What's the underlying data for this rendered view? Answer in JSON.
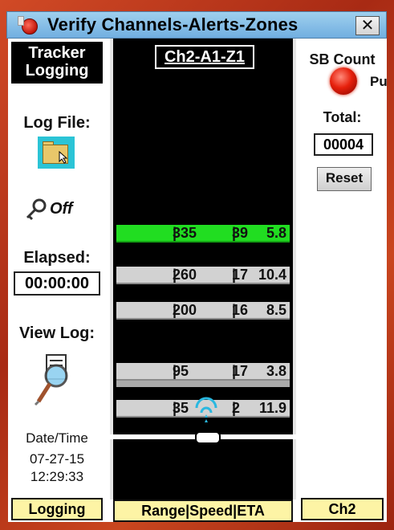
{
  "window": {
    "title": "Verify Channels-Alerts-Zones",
    "close_glyph": "✕"
  },
  "left_panel": {
    "tracker_label_line1": "Tracker",
    "tracker_label_line2": "Logging",
    "log_file_label": "Log File:",
    "logging_state": "Off",
    "elapsed_label": "Elapsed:",
    "elapsed_value": "00:00:00",
    "view_log_label": "View Log:",
    "datetime_label": "Date/Time",
    "date_value": "07-27-15",
    "time_value": "12:29:33",
    "status_button": "Logging"
  },
  "track": {
    "title": "Ch2-A1-Z1",
    "footer_label": "Range|Speed|ETA",
    "targets": [
      {
        "range": "335",
        "speed": "39",
        "eta": "5.8",
        "highlight": "green"
      },
      {
        "range": "260",
        "speed": "17",
        "eta": "10.4",
        "highlight": "gray"
      },
      {
        "range": "200",
        "speed": "16",
        "eta": "8.5",
        "highlight": "gray"
      },
      {
        "range": "95",
        "speed": "17",
        "eta": "3.8",
        "highlight": "gray"
      },
      {
        "range": "35",
        "speed": "2",
        "eta": "11.9",
        "highlight": "gray"
      }
    ],
    "separator": "|"
  },
  "right_panel": {
    "sb_count_label": "SB Count",
    "led_label": "Pu",
    "total_label": "Total:",
    "total_value": "00004",
    "reset_button": "Reset",
    "channel_button": "Ch2"
  },
  "colors": {
    "frame": "#c23a1e",
    "title_bar": "#80b9e6",
    "track_bg": "#000000",
    "target_gray": "#d2d2d2",
    "target_green": "#21dd21",
    "status_yellow": "#fdf4a5",
    "led_red": "#e6200c"
  },
  "icons": [
    "app-icon",
    "close-icon",
    "folder-icon",
    "key-icon",
    "view-log-icon",
    "radar-icon",
    "red-led-icon"
  ]
}
